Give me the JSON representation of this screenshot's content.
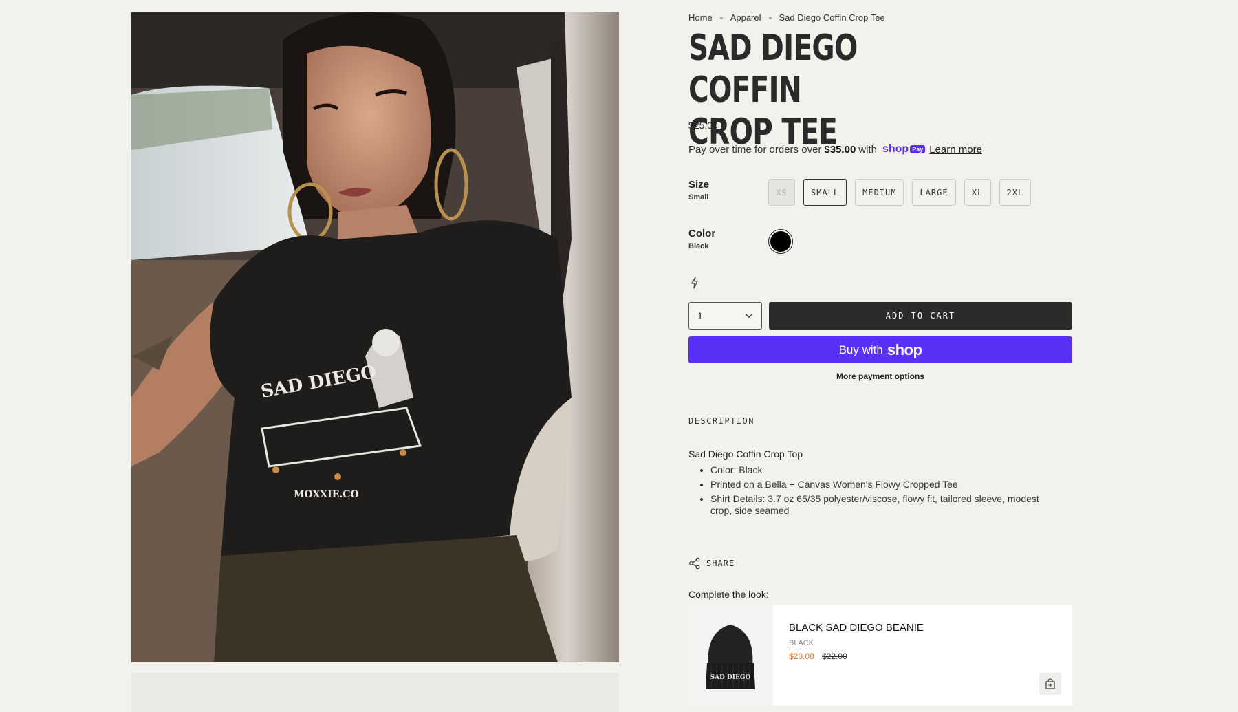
{
  "breadcrumb": {
    "home": "Home",
    "category": "Apparel",
    "current": "Sad Diego Coffin Crop Tee"
  },
  "product": {
    "title": "SAD DIEGO COFFIN\nCROP TEE",
    "price": "$25.00",
    "image_alt": "Woman wearing black Sad Diego coffin crop tee",
    "shirt_text": "SAD DIEGO",
    "shirt_brand": "MOXXIE.CO"
  },
  "installments": {
    "prefix": "Pay over time for orders over",
    "threshold": "$35.00",
    "with": "with",
    "shop_word": "shop",
    "pay_word": "Pay",
    "learn_more": "Learn more"
  },
  "options": {
    "size": {
      "label": "Size",
      "selected": "Small",
      "values": [
        "XS",
        "SMALL",
        "MEDIUM",
        "LARGE",
        "XL",
        "2XL"
      ]
    },
    "color": {
      "label": "Color",
      "selected": "Black",
      "swatch_color": "#000000"
    }
  },
  "purchase": {
    "quantity": "1",
    "add_to_cart": "ADD TO CART",
    "buy_with": "Buy with",
    "buy_shop_word": "shop",
    "more_payment": "More payment options"
  },
  "description": {
    "heading": "DESCRIPTION",
    "intro": "Sad Diego Coffin Crop Top",
    "bullets": [
      "Color: Black",
      "Printed on a Bella + Canvas Women's Flowy Cropped Tee",
      "Shirt Details: 3.7 oz 65/35 polyester/viscose, flowy fit, tailored sleeve, modest crop, side seamed"
    ]
  },
  "share": {
    "label": "SHARE"
  },
  "complete_the_look": {
    "label": "Complete the look:",
    "item": {
      "name": "BLACK SAD DIEGO BEANIE",
      "color": "BLACK",
      "sale_price": "$20.00",
      "original_price": "$22.00",
      "beanie_text": "SAD DIEGO"
    }
  },
  "colors": {
    "background": "#f2f1ec",
    "shop_pay_purple": "#5a31f4",
    "add_to_cart_bg": "#2b2b2a",
    "sale_price": "#e36c23"
  }
}
